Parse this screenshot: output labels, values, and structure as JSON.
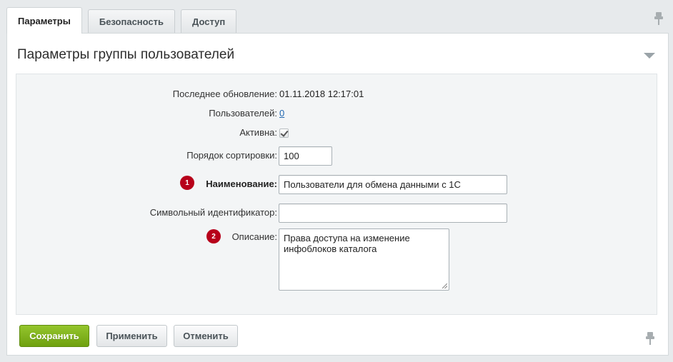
{
  "tabs": [
    {
      "label": "Параметры",
      "active": true
    },
    {
      "label": "Безопасность",
      "active": false
    },
    {
      "label": "Доступ",
      "active": false
    }
  ],
  "panel": {
    "title": "Параметры группы пользователей"
  },
  "form": {
    "last_update": {
      "label": "Последнее обновление:",
      "value": "01.11.2018 12:17:01"
    },
    "users": {
      "label": "Пользователей:",
      "value": "0"
    },
    "active": {
      "label": "Активна:",
      "checked": true
    },
    "sort": {
      "label": "Порядок сортировки:",
      "value": "100"
    },
    "name": {
      "label": "Наименование:",
      "value": "Пользователи для обмена данными с 1С",
      "badge": "1"
    },
    "code": {
      "label": "Символьный идентификатор:",
      "value": ""
    },
    "description": {
      "label": "Описание:",
      "value": "Права доступа на изменение инфоблоков каталога",
      "badge": "2"
    }
  },
  "buttons": {
    "save": "Сохранить",
    "apply": "Применить",
    "cancel": "Отменить"
  },
  "colors": {
    "save_button": "#7cb11a",
    "badge": "#b7001a",
    "link": "#2067b0"
  },
  "icons": [
    "pin-icon",
    "collapse-arrow-icon",
    "checkmark-icon"
  ]
}
